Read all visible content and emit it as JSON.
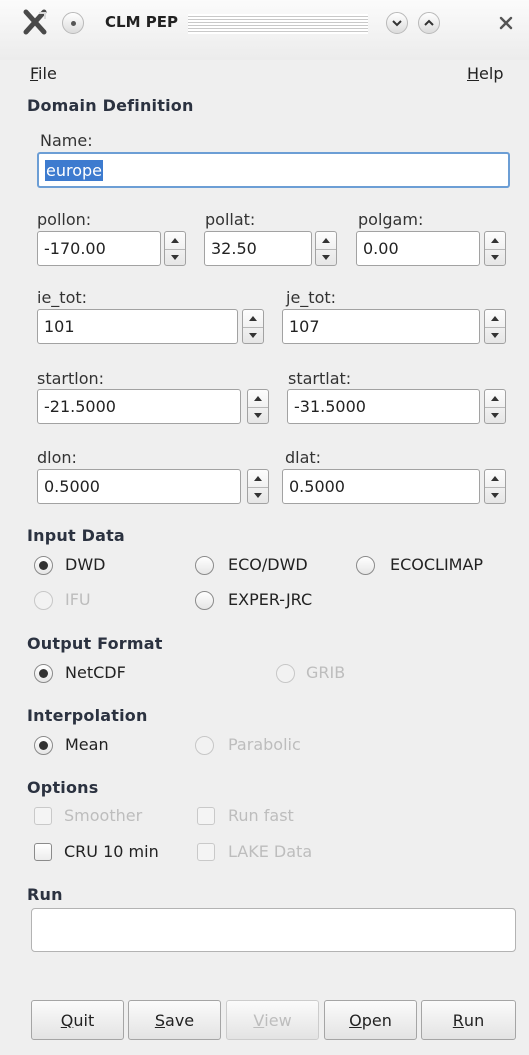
{
  "window": {
    "title": "CLM PEP",
    "app_icon": "kde-x-icon",
    "buttons": [
      "menu-dot-icon",
      "minimize-icon",
      "maximize-icon",
      "close-icon"
    ]
  },
  "menu": {
    "file": "File",
    "file_mnemonic": "F",
    "file_rest": "ile",
    "help": "Help",
    "help_mnemonic": "H",
    "help_rest": "elp"
  },
  "domain": {
    "heading": "Domain Definition",
    "name_label": "Name:",
    "name_value": "europe",
    "pollon": {
      "label": "pollon:",
      "value": "-170.00"
    },
    "pollat": {
      "label": "pollat:",
      "value": "32.50"
    },
    "polgam": {
      "label": "polgam:",
      "value": "0.00"
    },
    "ie_tot": {
      "label": "ie_tot:",
      "value": "101"
    },
    "je_tot": {
      "label": "je_tot:",
      "value": "107"
    },
    "startlon": {
      "label": "startlon:",
      "value": "-21.5000"
    },
    "startlat": {
      "label": "startlat:",
      "value": "-31.5000"
    },
    "dlon": {
      "label": "dlon:",
      "value": "0.5000"
    },
    "dlat": {
      "label": "dlat:",
      "value": "0.5000"
    }
  },
  "input_data": {
    "heading": "Input Data",
    "options": [
      {
        "label": "DWD",
        "checked": true,
        "enabled": true
      },
      {
        "label": "ECO/DWD",
        "checked": false,
        "enabled": true
      },
      {
        "label": "ECOCLIMAP",
        "checked": false,
        "enabled": true
      },
      {
        "label": "IFU",
        "checked": false,
        "enabled": false
      },
      {
        "label": "EXPER-JRC",
        "checked": false,
        "enabled": true
      }
    ]
  },
  "output_format": {
    "heading": "Output Format",
    "options": [
      {
        "label": "NetCDF",
        "checked": true,
        "enabled": true
      },
      {
        "label": "GRIB",
        "checked": false,
        "enabled": false
      }
    ]
  },
  "interpolation": {
    "heading": "Interpolation",
    "options": [
      {
        "label": "Mean",
        "checked": true,
        "enabled": true
      },
      {
        "label": "Parabolic",
        "checked": false,
        "enabled": false
      }
    ]
  },
  "options": {
    "heading": "Options",
    "items": [
      {
        "label": "Smoother",
        "checked": false,
        "enabled": false
      },
      {
        "label": "Run fast",
        "checked": false,
        "enabled": false
      },
      {
        "label": "CRU 10 min",
        "checked": false,
        "enabled": true
      },
      {
        "label": "LAKE Data",
        "checked": false,
        "enabled": false
      }
    ]
  },
  "run": {
    "heading": "Run",
    "value": ""
  },
  "buttons": {
    "quit": {
      "mnemonic": "Q",
      "rest": "uit"
    },
    "save": {
      "mnemonic": "S",
      "rest": "ave"
    },
    "view": {
      "mnemonic": "V",
      "rest": "iew",
      "enabled": false
    },
    "open": {
      "mnemonic": "O",
      "rest": "pen"
    },
    "run": {
      "mnemonic": "R",
      "rest": "un"
    }
  }
}
